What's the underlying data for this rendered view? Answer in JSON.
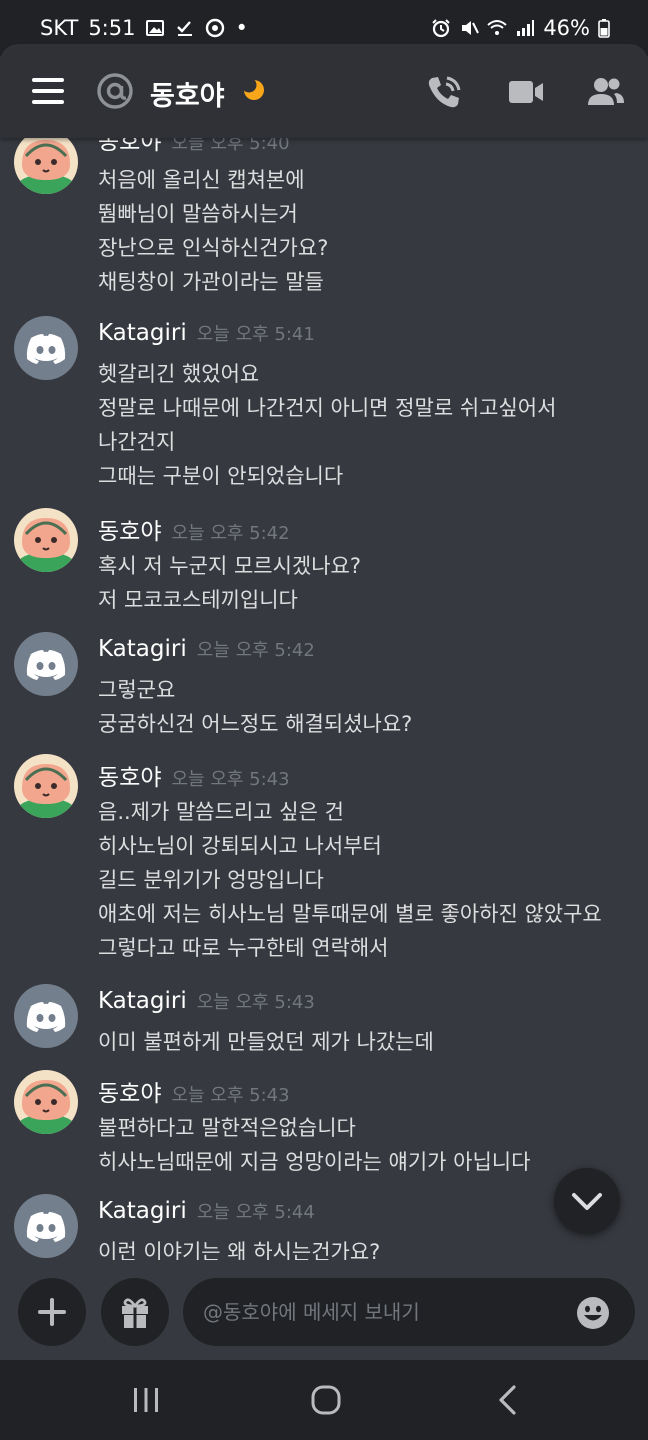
{
  "status_bar": {
    "carrier": "SKT",
    "time": "5:51",
    "dot": "•",
    "battery": "46%"
  },
  "header": {
    "title": "동호야",
    "icons": [
      "menu-icon",
      "at-icon",
      "moon-icon",
      "call-icon",
      "video-icon",
      "members-icon"
    ]
  },
  "messages": [
    {
      "author": "동호야",
      "avatar": "custom",
      "time": "오늘 오후 5:40",
      "lines": [
        "처음에 올리신 캡쳐본에",
        "뛈빠님이 말씀하시는거",
        "장난으로 인식하신건가요?",
        "채팅창이 가관이라는 말들"
      ]
    },
    {
      "author": "Katagiri",
      "avatar": "discord",
      "time": "오늘 오후 5:41",
      "lines": [
        "헷갈리긴 했었어요",
        "정말로 나때문에 나간건지 아니면 정말로 쉬고싶어서",
        "나간건지",
        "그때는 구분이 안되었습니다"
      ]
    },
    {
      "author": "동호야",
      "avatar": "custom",
      "time": "오늘 오후 5:42",
      "lines": [
        "혹시 저 누군지 모르시겠나요?",
        "저 모코코스테끼입니다"
      ]
    },
    {
      "author": "Katagiri",
      "avatar": "discord",
      "time": "오늘 오후 5:42",
      "lines": [
        "그렇군요",
        "궁굼하신건 어느정도 해결되셨나요?"
      ]
    },
    {
      "author": "동호야",
      "avatar": "custom",
      "time": "오늘 오후 5:43",
      "lines": [
        "음..제가 말씀드리고 싶은 건",
        "히사노님이 강퇴되시고 나서부터",
        "길드 분위기가 엉망입니다",
        "애초에 저는 히사노님 말투때문에 별로 좋아하진 않았구요",
        "그렇다고 따로 누구한테 연락해서"
      ]
    },
    {
      "author": "Katagiri",
      "avatar": "discord",
      "time": "오늘 오후 5:43",
      "lines": [
        "이미 불편하게 만들었던 제가 나갔는데"
      ]
    },
    {
      "author": "동호야",
      "avatar": "custom",
      "time": "오늘 오후 5:43",
      "lines": [
        "불편하다고 말한적은없습니다",
        "히사노님때문에 지금 엉망이라는 얘기가 아닙니다"
      ]
    },
    {
      "author": "Katagiri",
      "avatar": "discord",
      "time": "오늘 오후 5:44",
      "lines": [
        "이런 이야기는 왜 하시는건가요?"
      ]
    }
  ],
  "input": {
    "placeholder": "@동호야에 메세지 보내기"
  },
  "colors": {
    "background": "#36393f",
    "header": "#2f3136",
    "bars": "#202225",
    "text": "#dcddde",
    "timestamp": "#72767d",
    "discord_avatar": "#747f8d",
    "moon": "#faa61a"
  }
}
